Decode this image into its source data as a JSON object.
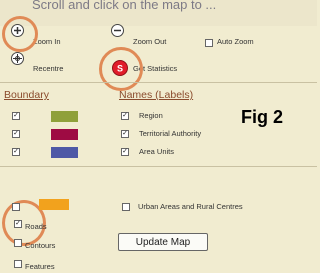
{
  "instruction": "Scroll and click on the map to ...",
  "tools": {
    "zoom_in": "Zoom In",
    "zoom_out": "Zoom Out",
    "auto_zoom": "Auto Zoom",
    "recentre": "Recentre",
    "get_statistics": "Get Statistics"
  },
  "headings": {
    "boundary": "Boundary",
    "names": "Names (Labels)"
  },
  "boundaries": [
    {
      "color": "#8fa03a",
      "label": "Region",
      "checked": true
    },
    {
      "color": "#9e0b43",
      "label": "Territorial Authority",
      "checked": true
    },
    {
      "color": "#4e58a6",
      "label": "Area Units",
      "checked": true
    }
  ],
  "urban_layer": {
    "color": "#f2a21d",
    "label": "Urban Areas and Rural Centres",
    "checked": false
  },
  "layers": [
    {
      "label": "Roads",
      "checked": true
    },
    {
      "label": "Contours",
      "checked": false
    },
    {
      "label": "Features",
      "checked": false
    }
  ],
  "update_button": "Update Map",
  "figure_label": "Fig 2",
  "colors": {
    "highlight_ring": "#e08a56",
    "stats_icon": "#e11c2a",
    "background": "#f1ecd0"
  }
}
